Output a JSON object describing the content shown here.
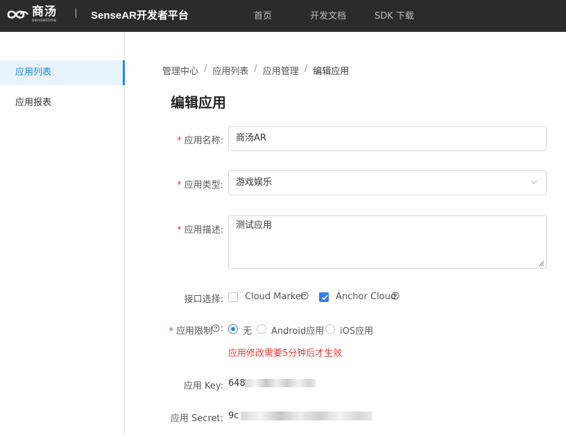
{
  "header": {
    "logo_cn": "商汤",
    "logo_en": "sensetime",
    "platform_title": "SenseAR开发者平台",
    "nav": [
      {
        "label": "首页"
      },
      {
        "label": "开发文档"
      },
      {
        "label": "SDK 下载"
      }
    ]
  },
  "sidebar": {
    "items": [
      {
        "label": "应用列表",
        "active": true
      },
      {
        "label": "应用报表",
        "active": false
      }
    ]
  },
  "breadcrumb": {
    "items": [
      "管理中心",
      "应用列表",
      "应用管理",
      "编辑应用"
    ],
    "separator": "/"
  },
  "page_title": "编辑应用",
  "form": {
    "name": {
      "label": "应用名称:",
      "value": "商汤AR",
      "required": true
    },
    "type": {
      "label": "应用类型:",
      "value": "游戏娱乐",
      "required": true
    },
    "description": {
      "label": "应用描述:",
      "value": "测试应用",
      "required": true
    },
    "interfaces": {
      "label": "接口选择:",
      "options": [
        {
          "label": "Cloud Marker",
          "checked": false
        },
        {
          "label": "Anchor Cloud",
          "checked": true
        }
      ]
    },
    "restriction": {
      "label": "应用限制",
      "required": true,
      "options": [
        {
          "label": "无",
          "checked": true
        },
        {
          "label": "Android应用",
          "checked": false
        },
        {
          "label": "iOS应用",
          "checked": false
        }
      ],
      "warning": "应用修改需要5分钟后才生效"
    },
    "app_key": {
      "label": "应用 Key:",
      "value_visible": "648"
    },
    "app_secret": {
      "label": "应用 Secret:",
      "value_visible": "9c"
    }
  },
  "colors": {
    "topbar": "#2b2b2b",
    "accent": "#2f80ed",
    "sidebar_active_bg": "#e8f4fd",
    "required": "#e53935"
  }
}
